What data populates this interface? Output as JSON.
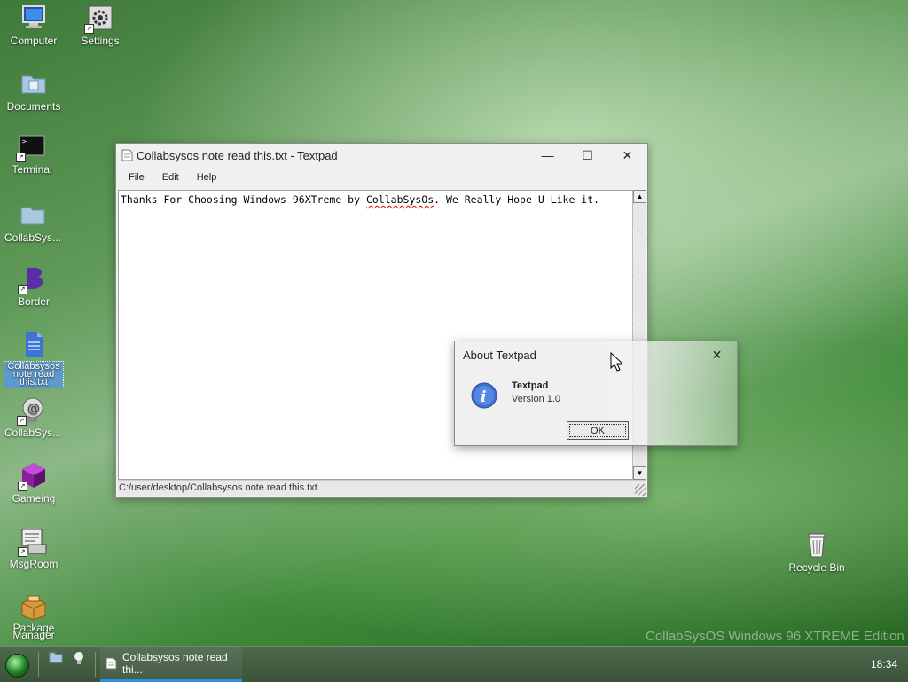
{
  "desktop_icons": [
    {
      "label": "Computer",
      "icon": "computer-icon"
    },
    {
      "label": "Settings",
      "icon": "settings-icon"
    },
    {
      "label": "Documents",
      "icon": "folder-icon"
    },
    {
      "label": "Terminal",
      "icon": "terminal-icon"
    },
    {
      "label": "CollabSys...",
      "icon": "folder-icon"
    },
    {
      "label": "Border",
      "icon": "border-icon"
    },
    {
      "label": "Collabsysos note read this.txt",
      "icon": "text-file-icon"
    },
    {
      "label": "CollabSys...",
      "icon": "collabsys-icon"
    },
    {
      "label": "Gameing",
      "icon": "game-cube-icon"
    },
    {
      "label": "MsgRoom",
      "icon": "msgroom-icon"
    },
    {
      "label": "Package Manager",
      "icon": "package-icon"
    },
    {
      "label": "Recycle Bin",
      "icon": "recycle-bin-icon"
    }
  ],
  "textpad": {
    "title": "Collabsysos note read this.txt - Textpad",
    "menu": [
      "File",
      "Edit",
      "Help"
    ],
    "content_before": "Thanks For Choosing Windows 96XTreme by ",
    "content_misspelled": "CollabSysOs",
    "content_after": ". We Really Hope U Like it.",
    "status_path": "C:/user/desktop/Collabsysos note read this.txt",
    "controls": {
      "minimize": "—",
      "maximize": "☐",
      "close": "✕"
    }
  },
  "about_dialog": {
    "title": "About Textpad",
    "app_name": "Textpad",
    "version": "Version 1.0",
    "ok_label": "OK",
    "close": "✕"
  },
  "taskbar": {
    "task_label": "Collabsysos note read thi...",
    "clock": "18:34"
  },
  "watermark": "CollabSysOS Windows 96 XTREME Edition",
  "colors": {
    "accent": "#2e8de0",
    "taskbar": "#3b5239",
    "info_icon": "#3d6fd1"
  }
}
